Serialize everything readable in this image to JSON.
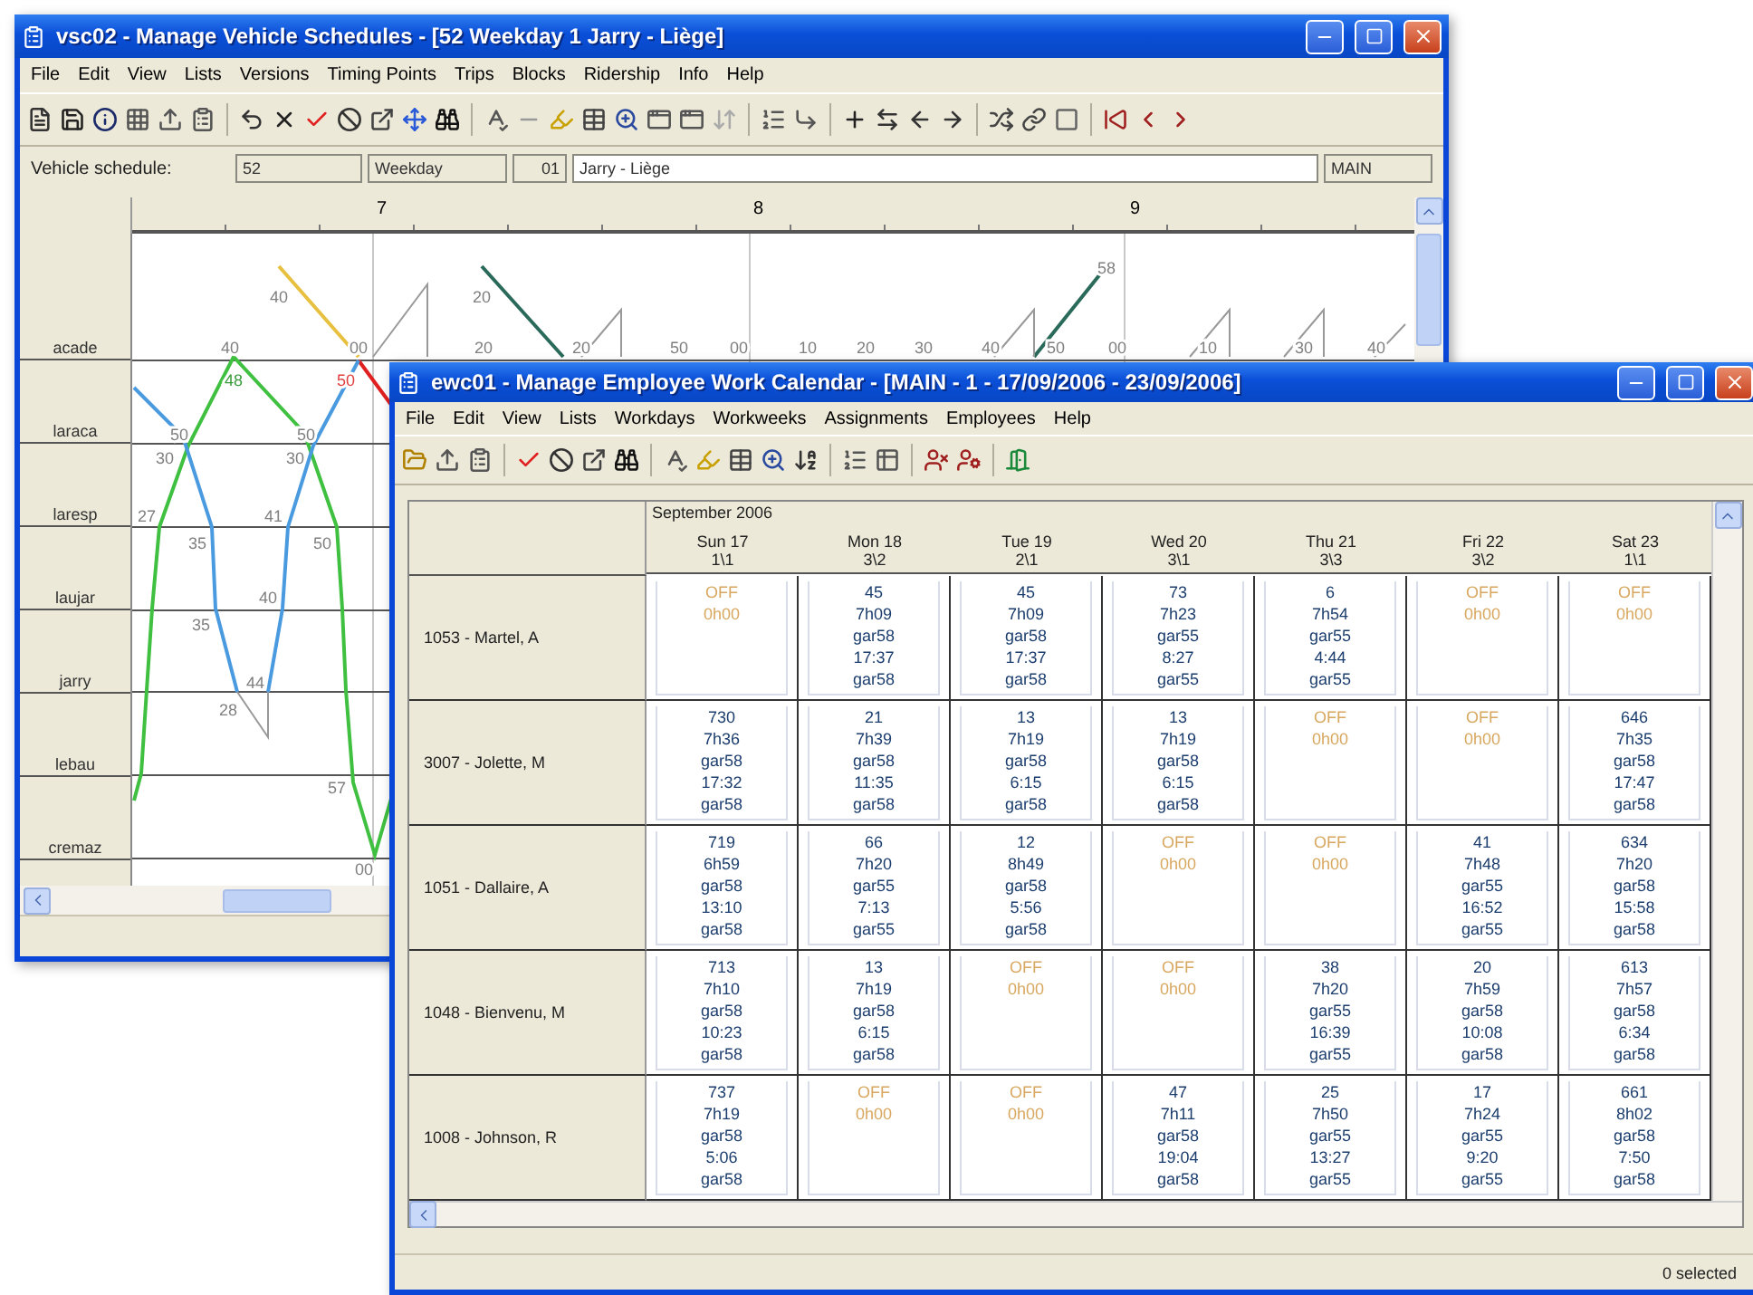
{
  "vehicle_window": {
    "title": "vsc02 - Manage Vehicle Schedules - [52 Weekday 1 Jarry - Liège]",
    "menu": [
      "File",
      "Edit",
      "View",
      "Lists",
      "Versions",
      "Timing Points",
      "Trips",
      "Blocks",
      "Ridership",
      "Info",
      "Help"
    ],
    "schedule_label": "Vehicle schedule:",
    "fields": [
      {
        "value": "52"
      },
      {
        "value": "Weekday"
      },
      {
        "value": "01"
      },
      {
        "value": "Jarry - Liège"
      },
      {
        "value": "MAIN"
      }
    ],
    "ruler_hours": [
      "7",
      "8",
      "9"
    ],
    "stops": [
      "acade",
      "laraca",
      "laresp",
      "laujar",
      "jarry",
      "lebau",
      "cremaz"
    ],
    "minute_labels": [
      {
        "text": "40",
        "color": "#808080"
      },
      {
        "text": "20",
        "color": "#808080"
      },
      {
        "text": "58",
        "color": "#808080"
      },
      {
        "text": "40",
        "color": "#808080"
      },
      {
        "text": "00",
        "color": "#808080"
      },
      {
        "text": "20",
        "color": "#808080"
      },
      {
        "text": "20",
        "color": "#808080"
      },
      {
        "text": "50",
        "color": "#808080"
      },
      {
        "text": "00",
        "color": "#808080"
      },
      {
        "text": "10",
        "color": "#808080"
      },
      {
        "text": "20",
        "color": "#808080"
      },
      {
        "text": "30",
        "color": "#808080"
      },
      {
        "text": "40",
        "color": "#808080"
      },
      {
        "text": "50",
        "color": "#808080"
      },
      {
        "text": "00",
        "color": "#808080"
      },
      {
        "text": "10",
        "color": "#808080"
      },
      {
        "text": "30",
        "color": "#808080"
      },
      {
        "text": "40",
        "color": "#808080"
      },
      {
        "text": "48",
        "color": "#3a9a3a"
      },
      {
        "text": "50",
        "color": "#e04040"
      },
      {
        "text": "50",
        "color": "#808080"
      },
      {
        "text": "50",
        "color": "#808080"
      },
      {
        "text": "30",
        "color": "#808080"
      },
      {
        "text": "30",
        "color": "#808080"
      },
      {
        "text": "27",
        "color": "#808080"
      },
      {
        "text": "35",
        "color": "#808080"
      },
      {
        "text": "41",
        "color": "#808080"
      },
      {
        "text": "50",
        "color": "#808080"
      },
      {
        "text": "40",
        "color": "#808080"
      },
      {
        "text": "35",
        "color": "#808080"
      },
      {
        "text": "44",
        "color": "#808080"
      },
      {
        "text": "28",
        "color": "#808080"
      },
      {
        "text": "57",
        "color": "#808080"
      },
      {
        "text": "00",
        "color": "#808080"
      }
    ]
  },
  "calendar_window": {
    "title": "ewc01 - Manage Employee Work Calendar - [MAIN - 1 - 17/09/2006 - 23/09/2006]",
    "menu": [
      "File",
      "Edit",
      "View",
      "Lists",
      "Workdays",
      "Workweeks",
      "Assignments",
      "Employees",
      "Help"
    ],
    "month": "September 2006",
    "days": [
      {
        "label": "Sun 17",
        "code": "1\\1"
      },
      {
        "label": "Mon 18",
        "code": "3\\2"
      },
      {
        "label": "Tue 19",
        "code": "2\\1"
      },
      {
        "label": "Wed 20",
        "code": "3\\1"
      },
      {
        "label": "Thu 21",
        "code": "3\\3"
      },
      {
        "label": "Fri 22",
        "code": "3\\2"
      },
      {
        "label": "Sat 23",
        "code": "1\\1"
      }
    ],
    "employees": [
      {
        "name": "1053 - Martel, A",
        "cells": [
          {
            "kind": "off",
            "lines": [
              "OFF",
              "0h00"
            ]
          },
          {
            "kind": "work",
            "lines": [
              "45",
              "7h09",
              "gar58",
              "17:37",
              "gar58"
            ]
          },
          {
            "kind": "work",
            "lines": [
              "45",
              "7h09",
              "gar58",
              "17:37",
              "gar58"
            ]
          },
          {
            "kind": "work",
            "lines": [
              "73",
              "7h23",
              "gar55",
              "8:27",
              "gar55"
            ]
          },
          {
            "kind": "work",
            "lines": [
              "6",
              "7h54",
              "gar55",
              "4:44",
              "gar55"
            ]
          },
          {
            "kind": "off",
            "lines": [
              "OFF",
              "0h00"
            ]
          },
          {
            "kind": "off",
            "lines": [
              "OFF",
              "0h00"
            ]
          }
        ]
      },
      {
        "name": "3007 - Jolette, M",
        "cells": [
          {
            "kind": "work",
            "lines": [
              "730",
              "7h36",
              "gar58",
              "17:32",
              "gar58"
            ]
          },
          {
            "kind": "work",
            "lines": [
              "21",
              "7h39",
              "gar58",
              "11:35",
              "gar58"
            ]
          },
          {
            "kind": "work",
            "lines": [
              "13",
              "7h19",
              "gar58",
              "6:15",
              "gar58"
            ]
          },
          {
            "kind": "work",
            "lines": [
              "13",
              "7h19",
              "gar58",
              "6:15",
              "gar58"
            ]
          },
          {
            "kind": "off",
            "lines": [
              "OFF",
              "0h00"
            ]
          },
          {
            "kind": "off",
            "lines": [
              "OFF",
              "0h00"
            ]
          },
          {
            "kind": "work",
            "lines": [
              "646",
              "7h35",
              "gar58",
              "17:47",
              "gar58"
            ]
          }
        ]
      },
      {
        "name": "1051 - Dallaire, A",
        "cells": [
          {
            "kind": "work",
            "lines": [
              "719",
              "6h59",
              "gar58",
              "13:10",
              "gar58"
            ]
          },
          {
            "kind": "work",
            "lines": [
              "66",
              "7h20",
              "gar55",
              "7:13",
              "gar55"
            ]
          },
          {
            "kind": "work",
            "lines": [
              "12",
              "8h49",
              "gar58",
              "5:56",
              "gar58"
            ]
          },
          {
            "kind": "off",
            "lines": [
              "OFF",
              "0h00"
            ]
          },
          {
            "kind": "off",
            "lines": [
              "OFF",
              "0h00"
            ]
          },
          {
            "kind": "work",
            "lines": [
              "41",
              "7h48",
              "gar55",
              "16:52",
              "gar55"
            ]
          },
          {
            "kind": "work",
            "lines": [
              "634",
              "7h20",
              "gar58",
              "15:58",
              "gar58"
            ]
          }
        ]
      },
      {
        "name": "1048 - Bienvenu, M",
        "cells": [
          {
            "kind": "work",
            "lines": [
              "713",
              "7h10",
              "gar58",
              "10:23",
              "gar58"
            ]
          },
          {
            "kind": "work",
            "lines": [
              "13",
              "7h19",
              "gar58",
              "6:15",
              "gar58"
            ]
          },
          {
            "kind": "off",
            "lines": [
              "OFF",
              "0h00"
            ]
          },
          {
            "kind": "off",
            "lines": [
              "OFF",
              "0h00"
            ]
          },
          {
            "kind": "work",
            "lines": [
              "38",
              "7h20",
              "gar55",
              "16:39",
              "gar55"
            ]
          },
          {
            "kind": "work",
            "lines": [
              "20",
              "7h59",
              "gar58",
              "10:08",
              "gar58"
            ]
          },
          {
            "kind": "work",
            "lines": [
              "613",
              "7h57",
              "gar58",
              "6:34",
              "gar58"
            ]
          }
        ]
      },
      {
        "name": "1008 - Johnson, R",
        "cells": [
          {
            "kind": "work",
            "lines": [
              "737",
              "7h19",
              "gar58",
              "5:06",
              "gar58"
            ]
          },
          {
            "kind": "off",
            "lines": [
              "OFF",
              "0h00"
            ]
          },
          {
            "kind": "off",
            "lines": [
              "OFF",
              "0h00"
            ]
          },
          {
            "kind": "work",
            "lines": [
              "47",
              "7h11",
              "gar58",
              "19:04",
              "gar58"
            ]
          },
          {
            "kind": "work",
            "lines": [
              "25",
              "7h50",
              "gar55",
              "13:27",
              "gar55"
            ]
          },
          {
            "kind": "work",
            "lines": [
              "17",
              "7h24",
              "gar55",
              "9:20",
              "gar55"
            ]
          },
          {
            "kind": "work",
            "lines": [
              "661",
              "8h02",
              "gar58",
              "7:50",
              "gar58"
            ]
          }
        ]
      }
    ],
    "status": "0 selected"
  }
}
